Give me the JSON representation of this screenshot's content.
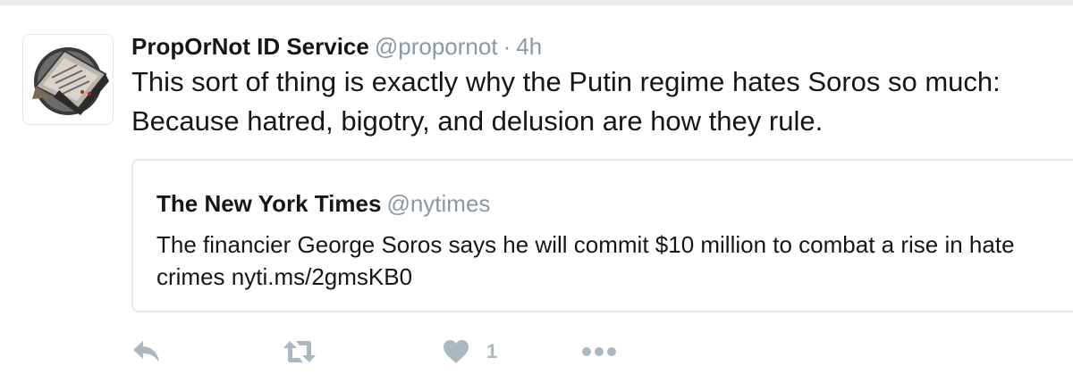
{
  "tweet": {
    "author_name": "PropOrNot ID Service",
    "author_handle": "@propornot",
    "separator": "·",
    "time": "4h",
    "text": "This sort of thing is exactly why the Putin regime hates Soros so much: Because hatred, bigotry, and delusion are how they rule."
  },
  "quoted_tweet": {
    "author_name": "The New York Times",
    "author_handle": "@nytimes",
    "text": "The financier George Soros says he will commit $10 million to combat a rise in hate crimes nyti.ms/2gmsKB0"
  },
  "actions": {
    "reply_icon": "reply-icon",
    "retweet_icon": "retweet-icon",
    "like_icon": "heart-icon",
    "like_count": "1",
    "more_icon": "more-dots-icon"
  },
  "colors": {
    "text": "#14171a",
    "muted": "#8899a6",
    "icon": "#aab8c2",
    "border": "#e1e8ed"
  }
}
